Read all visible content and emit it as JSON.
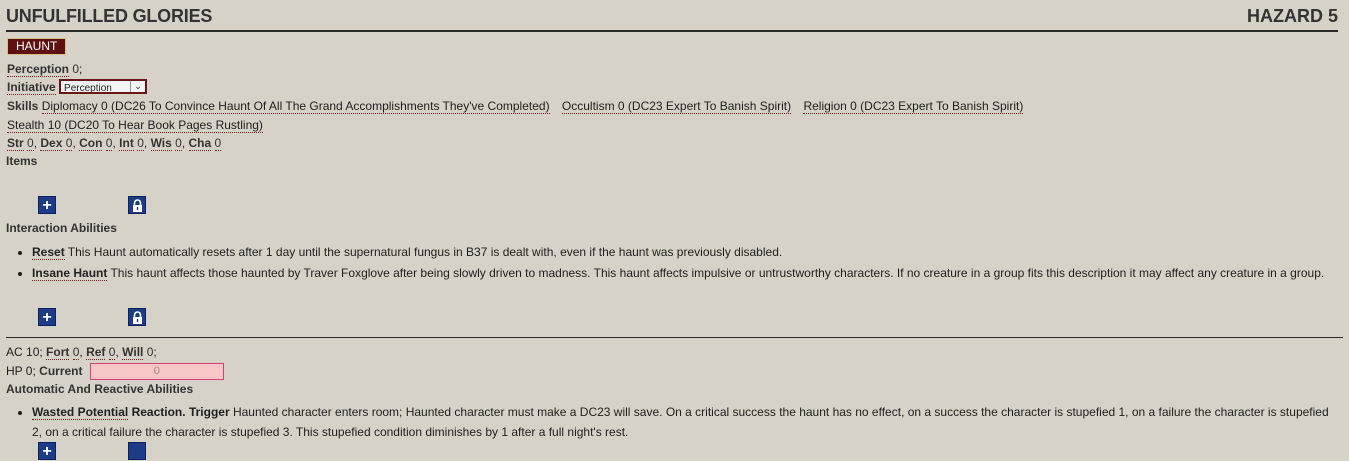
{
  "header": {
    "title": "UNFULFILLED GLORIES",
    "level": "HAZARD 5"
  },
  "trait": "HAUNT",
  "perception": {
    "label": "Perception",
    "value": "0",
    "sep": ";"
  },
  "initiative": {
    "label": "Initiative",
    "selected": "Perception"
  },
  "skills": {
    "label": "Skills",
    "items": [
      "Diplomacy 0 (DC26 To Convince Haunt Of All The Grand Accomplishments They've Completed)",
      "Occultism 0 (DC23 Expert To Banish Spirit)",
      "Religion 0 (DC23 Expert To Banish Spirit)",
      "Stealth 10 (DC20 To Hear Book Pages Rustling)"
    ]
  },
  "abilities": [
    {
      "label": "Str",
      "value": "0"
    },
    {
      "label": "Dex",
      "value": "0"
    },
    {
      "label": "Con",
      "value": "0"
    },
    {
      "label": "Int",
      "value": "0"
    },
    {
      "label": "Wis",
      "value": "0"
    },
    {
      "label": "Cha",
      "value": "0"
    }
  ],
  "sep_comma": ",",
  "items_label": "Items",
  "interaction": {
    "heading": "Interaction Abilities",
    "list": [
      {
        "name": "Reset",
        "text": " This Haunt automatically resets after 1 day until the supernatural fungus in B37 is dealt with, even if the haunt was previously disabled."
      },
      {
        "name": "Insane Haunt",
        "text": " This haunt affects those haunted by Traver Foxglove after being slowly driven to madness. This haunt affects impulsive or untrustworthy characters. If no creature in a group fits this description it may affect any creature in a group."
      }
    ]
  },
  "defense": {
    "ac_label": "AC",
    "ac_value": "10;",
    "saves": [
      {
        "label": "Fort",
        "value": "0"
      },
      {
        "label": "Ref",
        "value": "0"
      },
      {
        "label": "Will",
        "value": "0;"
      }
    ],
    "hp_label": "HP",
    "hp_value": "0;",
    "current_label": "Current",
    "current_placeholder": "0"
  },
  "reactive": {
    "heading": "Automatic And Reactive Abilities",
    "list": [
      {
        "name": "Wasted Potential",
        "type": "Reaction.",
        "trigger_label": "Trigger",
        "text": " Haunted character enters room; Haunted character must make a DC23 will save. On a critical success the haunt has no effect, on a success the character is stupefied 1, on a failure the character is stupefied 2, on a critical failure the character is stupefied 3. This stupefied condition diminishes by 1 after a full night's rest."
      }
    ]
  },
  "icons": {
    "add": "plus-icon",
    "lock": "lock-icon"
  },
  "colors": {
    "trait_bg": "#5e1010",
    "button_bg": "#1e3b86",
    "hp_input_bg": "#f8c6c6",
    "background": "#d7d2c8"
  }
}
